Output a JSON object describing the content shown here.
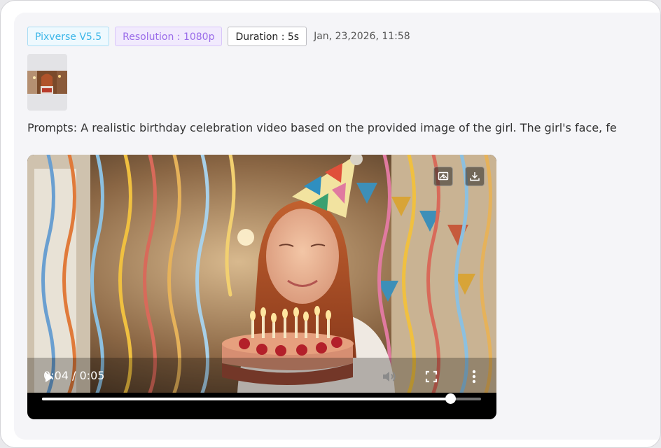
{
  "tags": {
    "model": "Pixverse V5.5",
    "resolution": "Resolution : 1080p",
    "duration": "Duration : 5s"
  },
  "timestamp": "Jan, 23,2026, 11:58",
  "prompt": {
    "text": "Prompts: A realistic birthday celebration video based on the provided image of the girl. The girl's face, fe"
  },
  "video": {
    "time_display": "0:04 / 0:05",
    "progress": 0.93,
    "icons": [
      "play-icon",
      "volume-icon",
      "fullscreen-icon",
      "more-options-icon",
      "add-image-icon",
      "download-icon"
    ]
  },
  "colors": {
    "model_tag": "#3bb6e8",
    "resolution_tag": "#9a6ce9",
    "card_bg": "#f5f5f8"
  }
}
